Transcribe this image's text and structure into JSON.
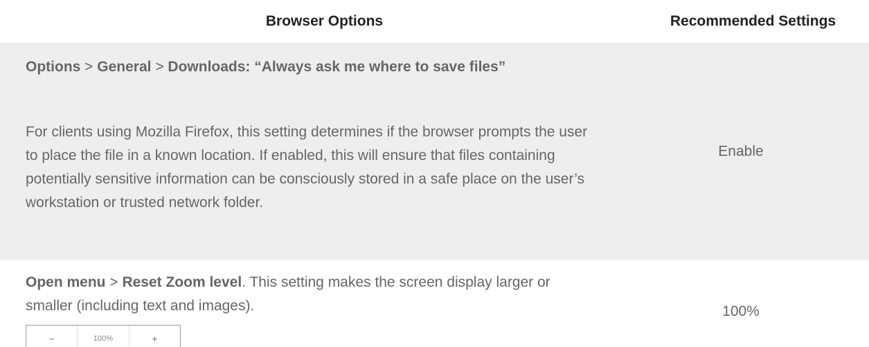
{
  "header": {
    "col_options": "Browser Options",
    "col_settings": "Recommended Settings"
  },
  "rows": [
    {
      "path": [
        {
          "text": "Options",
          "bold": true
        },
        {
          "text": " > ",
          "bold": false
        },
        {
          "text": "General",
          "bold": true
        },
        {
          "text": " > ",
          "bold": false
        },
        {
          "text": "Downloads: “Always ask me where to save files”",
          "bold": true
        }
      ],
      "description": "For clients using Mozilla Firefox, this setting determines if the browser prompts the user to place the file in a known location. If enabled, this will ensure that files containing potentially sensitive information can be consciously stored in a safe place on the user’s workstation or trusted network folder.",
      "recommended": "Enable"
    },
    {
      "path": [
        {
          "text": "Open menu",
          "bold": true
        },
        {
          "text": " > ",
          "bold": false
        },
        {
          "text": "Reset Zoom level",
          "bold": true
        }
      ],
      "description": ". This setting makes the screen display larger or smaller (including text and images).",
      "recommended": "100%",
      "zoom_widget": {
        "minus": "−",
        "level": "100%",
        "plus": "+"
      }
    }
  ]
}
